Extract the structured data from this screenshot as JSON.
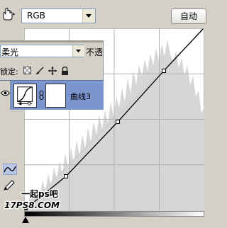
{
  "curves": {
    "channel": "RGB",
    "auto_label": "自动"
  },
  "layers": {
    "blend_mode": "柔光",
    "opacity_label": "不透",
    "lock_label": "锁定:",
    "layer_name": "曲线3"
  },
  "watermark": {
    "line1": "一起ps吧",
    "line2": "17PS8.COM"
  },
  "colors": {
    "layer_selected": "#7b95cf",
    "panel_bg": "#d4d0c8",
    "histogram": "#d6d6d6"
  },
  "icons": [
    "hand-point-icon",
    "eyedropper-icon",
    "dropdown-arrow-icon",
    "lock-transparent-icon",
    "lock-brush-icon",
    "lock-move-icon",
    "lock-all-icon",
    "eye-icon",
    "link-icon",
    "curve-tool-icon",
    "pencil-tool-icon"
  ]
}
